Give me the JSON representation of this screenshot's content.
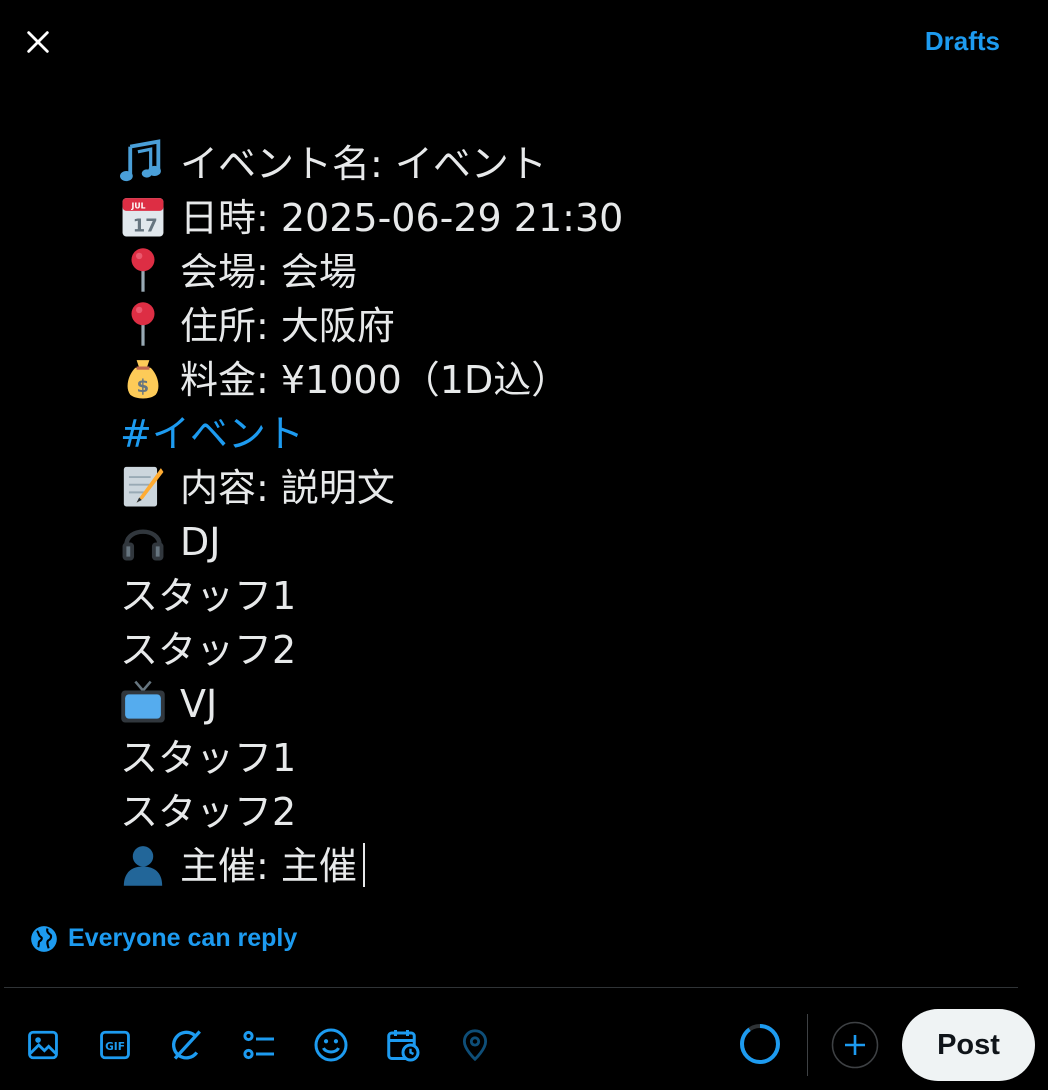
{
  "header": {
    "drafts_label": "Drafts"
  },
  "composer": {
    "lines": [
      {
        "icon": "musical-notes-icon",
        "text": "イベント名: イベント"
      },
      {
        "icon": "calendar-icon",
        "text": "日時: 2025-06-29 21:30"
      },
      {
        "icon": "round-pushpin-icon",
        "text": "会場: 会場"
      },
      {
        "icon": "round-pushpin-icon",
        "text": "住所: 大阪府"
      },
      {
        "icon": "money-bag-icon",
        "text": "料金: ¥1000（1D込）"
      },
      {
        "icon": "",
        "text": "#イベント"
      },
      {
        "icon": "memo-icon",
        "text": "内容: 説明文"
      },
      {
        "icon": "headphone-icon",
        "text": "DJ"
      },
      {
        "icon": "",
        "text": "スタッフ1"
      },
      {
        "icon": "",
        "text": "スタッフ2"
      },
      {
        "icon": "television-icon",
        "text": "VJ"
      },
      {
        "icon": "",
        "text": "スタッフ1"
      },
      {
        "icon": "",
        "text": "スタッフ2"
      },
      {
        "icon": "bust-silhouette-icon",
        "text": "主催: 主催"
      }
    ]
  },
  "reply_setting": {
    "label": "Everyone can reply"
  },
  "toolbar": {
    "icons": [
      "image-icon",
      "gif-icon",
      "grok-icon",
      "poll-icon",
      "emoji-icon",
      "schedule-icon",
      "location-icon"
    ],
    "character_progress": 0.9,
    "post_label": "Post"
  },
  "colors": {
    "accent": "#1d9bf0",
    "background": "#000000",
    "text": "#e7e9ea",
    "post_button_bg": "#eff3f4"
  }
}
